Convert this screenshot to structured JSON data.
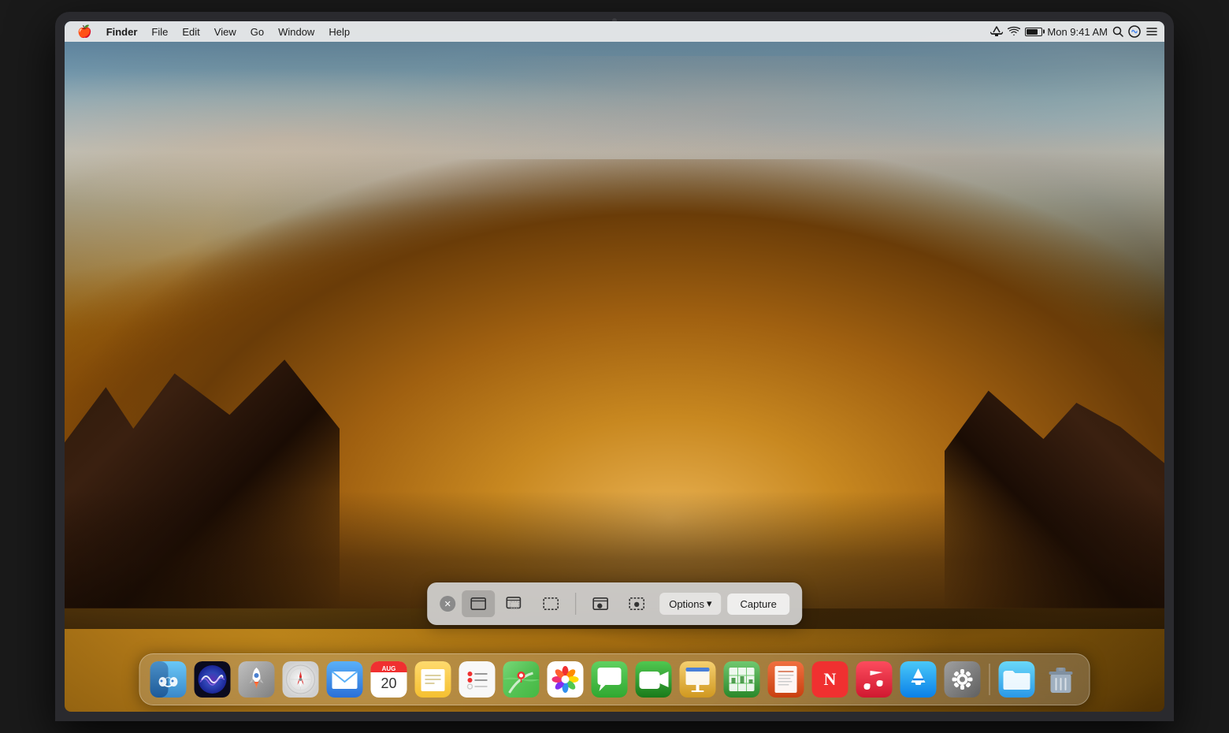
{
  "laptop": {
    "camera_label": "camera"
  },
  "menubar": {
    "apple_symbol": "🍎",
    "items": [
      {
        "label": "Finder",
        "bold": true
      },
      {
        "label": "File"
      },
      {
        "label": "Edit"
      },
      {
        "label": "View"
      },
      {
        "label": "Go"
      },
      {
        "label": "Window"
      },
      {
        "label": "Help"
      }
    ],
    "clock": "Mon 9:41 AM",
    "right_icons": [
      "airplay",
      "wifi",
      "battery",
      "search",
      "siri",
      "control-center"
    ]
  },
  "screenshot_toolbar": {
    "close_label": "×",
    "modes": [
      {
        "id": "capture-window",
        "label": "Capture Window"
      },
      {
        "id": "capture-window-shadow",
        "label": "Capture Window with Shadow"
      },
      {
        "id": "capture-selection",
        "label": "Capture Selection"
      },
      {
        "id": "record-screen",
        "label": "Record Screen"
      },
      {
        "id": "record-selection",
        "label": "Record Selection"
      }
    ],
    "options_label": "Options",
    "options_arrow": "▾",
    "capture_label": "Capture"
  },
  "dock": {
    "items": [
      {
        "id": "finder",
        "label": "Finder",
        "color_start": "#6AC4F8",
        "color_end": "#2E6EA8"
      },
      {
        "id": "siri",
        "label": "Siri",
        "color_start": "#1a1a2e",
        "color_end": "#3a3a6e"
      },
      {
        "id": "launchpad",
        "label": "Launchpad",
        "color_start": "#3A7BD5",
        "color_end": "#3A9D8C"
      },
      {
        "id": "safari",
        "label": "Safari",
        "color_start": "#f0f0f0",
        "color_end": "#d0d0d0"
      },
      {
        "id": "mail",
        "label": "Mail",
        "color_start": "#5B9FF5",
        "color_end": "#3A7BD5"
      },
      {
        "id": "calendar",
        "label": "Calendar",
        "color_start": "#ffffff",
        "color_end": "#f0f0f0"
      },
      {
        "id": "notes",
        "label": "Notes",
        "color_start": "#FFDA6E",
        "color_end": "#F5C842"
      },
      {
        "id": "reminders",
        "label": "Reminders",
        "color_start": "#f8f8f8",
        "color_end": "#e8e8e8"
      },
      {
        "id": "maps",
        "label": "Maps",
        "color_start": "#5AC85A",
        "color_end": "#3A983A"
      },
      {
        "id": "photos",
        "label": "Photos",
        "color_start": "#ffffff",
        "color_end": "#f0f0f0"
      },
      {
        "id": "messages",
        "label": "Messages",
        "color_start": "#5CC85C",
        "color_end": "#3AA83A"
      },
      {
        "id": "facetime",
        "label": "FaceTime",
        "color_start": "#5CC85C",
        "color_end": "#2A882A"
      },
      {
        "id": "keynote",
        "label": "Keynote",
        "color_start": "#2A6EC8",
        "color_end": "#1A4E98"
      },
      {
        "id": "numbers",
        "label": "Numbers",
        "color_start": "#3DA83D",
        "color_end": "#2A882A"
      },
      {
        "id": "pages",
        "label": "Pages",
        "color_start": "#E85A28",
        "color_end": "#C84018"
      },
      {
        "id": "news",
        "label": "News",
        "color_start": "#F03030",
        "color_end": "#D01010"
      },
      {
        "id": "music",
        "label": "Music",
        "color_start": "#FC3C44",
        "color_end": "#D8202A"
      },
      {
        "id": "appstore",
        "label": "App Store",
        "color_start": "#2BADF8",
        "color_end": "#0A8AE0"
      },
      {
        "id": "systemprefs",
        "label": "System Preferences",
        "color_start": "#8A8A8A",
        "color_end": "#5A5A5A"
      },
      {
        "id": "files",
        "label": "Files",
        "color_start": "#5AC8FA",
        "color_end": "#2AAADA"
      },
      {
        "id": "trash",
        "label": "Trash",
        "color_start": "#c0c8d0",
        "color_end": "#909aa4"
      }
    ]
  }
}
